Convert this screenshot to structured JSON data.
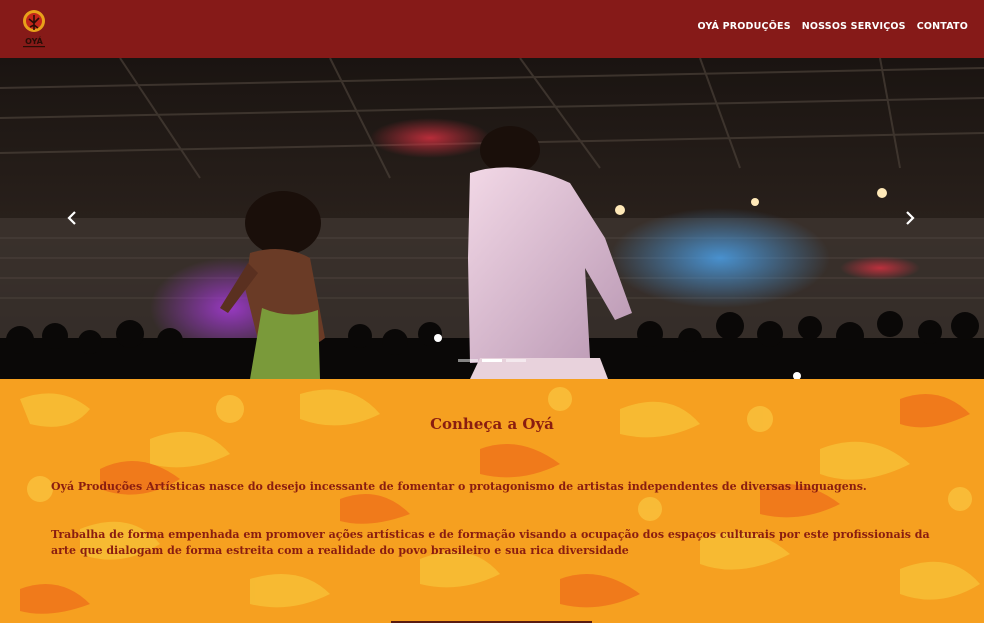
{
  "header": {
    "logo_icon": "oya-logo-icon",
    "logo_text": "OYÁ",
    "nav_links": [
      "OYÁ PRODUÇÕES",
      "NOSSOS SERVIÇOS",
      "CONTATO"
    ]
  },
  "carousel": {
    "prev_icon": "chevron-left-icon",
    "next_icon": "chevron-right-icon",
    "slide_count": 3,
    "active_slide": 2
  },
  "about": {
    "title": "Conheça a Oyá",
    "paragraph_1": "Oyá Produções Artísticas nasce do desejo incessante de fomentar o protagonismo de artistas independentes de diversas linguagens.",
    "paragraph_2": "Trabalha de forma empenhada em promover ações artísticas e de formação visando a ocupação dos espaços culturais por este profissionais da arte que dialogam de forma estreita com a realidade do povo brasileiro e sua rica diversidade"
  },
  "colors": {
    "navbar": "#861a18",
    "about_text": "#8a1d10",
    "orange": "#f39a1c"
  }
}
